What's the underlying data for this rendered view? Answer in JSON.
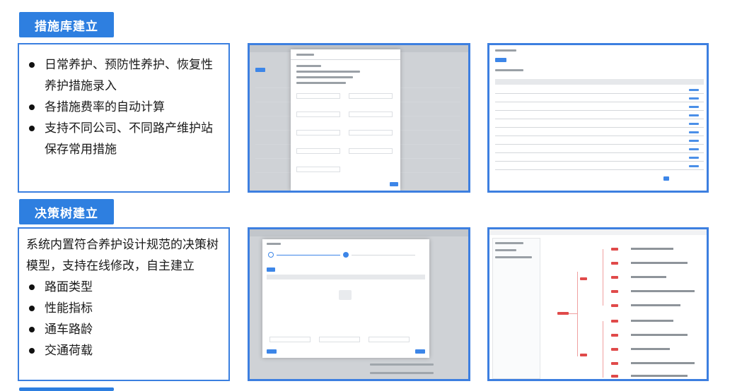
{
  "section1": {
    "title": "措施库建立",
    "bullets": [
      "日常养护、预防性养护、恢复性养护措施录入",
      "各措施费率的自动计算",
      "支持不同公司、不同路产维护站保存常用措施"
    ]
  },
  "section2": {
    "title": "决策树建立",
    "intro": "系统内置符合养护设计规范的决策树模型，支持在线修改，自主建立",
    "bullets": [
      "路面类型",
      "性能指标",
      "通车路龄",
      "交通荷载"
    ]
  },
  "screenshots": [
    {
      "name": "measure-edit-dialog"
    },
    {
      "name": "measure-list"
    },
    {
      "name": "decision-tree-wizard"
    },
    {
      "name": "decision-tree-view"
    }
  ],
  "colors": {
    "accent": "#2e7fe0",
    "border": "#3a7fe0"
  }
}
